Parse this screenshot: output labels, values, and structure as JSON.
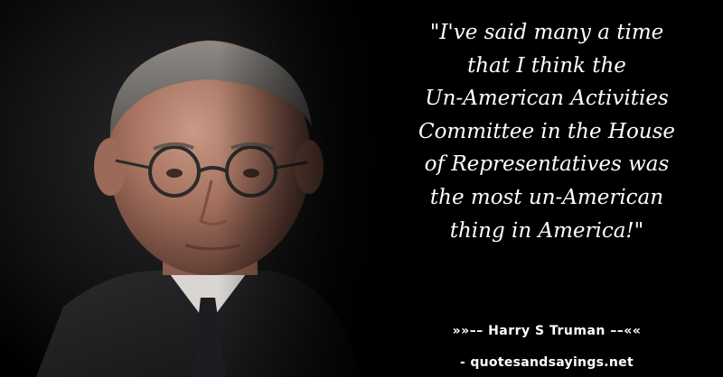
{
  "quote": {
    "lines": [
      "\"I've said many a time",
      "that I think the",
      "Un-American Activities",
      "Committee in the House",
      "of Representatives was",
      "the most un-American",
      "thing in America!\""
    ]
  },
  "author": {
    "text": "»»–– Harry S Truman ––««"
  },
  "source": {
    "text": "- quotesandsayings.net"
  },
  "portrait": {
    "subject": "portrait-photo"
  },
  "colors": {
    "background": "#000000",
    "text": "#ffffff"
  }
}
